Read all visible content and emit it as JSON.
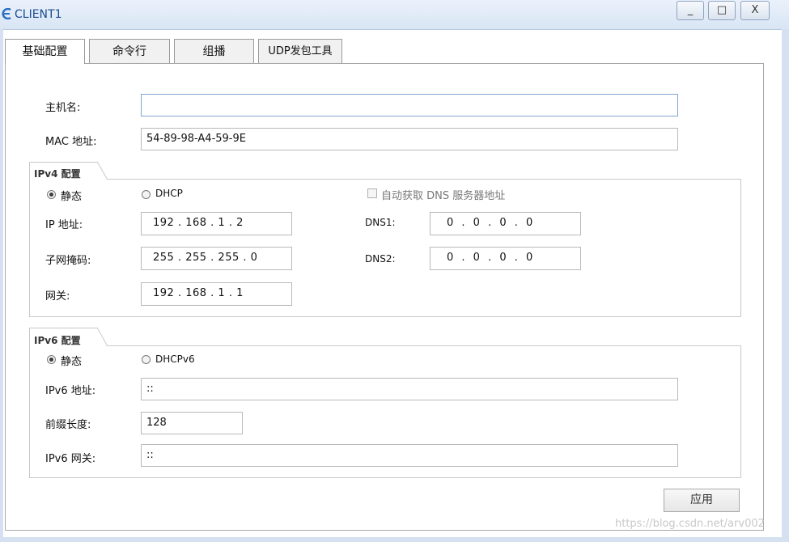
{
  "window": {
    "title": "CLIENT1",
    "minimize": "_",
    "maximize": "□",
    "close": "X"
  },
  "tabs": [
    {
      "label": "基础配置",
      "active": true
    },
    {
      "label": "命令行",
      "active": false
    },
    {
      "label": "组播",
      "active": false
    },
    {
      "label": "UDP发包工具",
      "active": false
    }
  ],
  "form": {
    "hostname_label": "主机名:",
    "hostname_value": "",
    "mac_label": "MAC 地址:",
    "mac_value": "54-89-98-A4-59-9E"
  },
  "ipv4": {
    "title": "IPv4 配置",
    "static_label": "静态",
    "dhcp_label": "DHCP",
    "auto_dns_label": "自动获取 DNS 服务器地址",
    "ip_label": "IP 地址:",
    "ip_value": "192 . 168 . 1 . 2",
    "mask_label": "子网掩码:",
    "mask_value": "255 . 255 . 255 . 0",
    "gateway_label": "网关:",
    "gateway_value": "192 . 168 . 1 . 1",
    "dns1_label": "DNS1:",
    "dns1_value": "0 . 0 . 0 . 0",
    "dns2_label": "DNS2:",
    "dns2_value": "0 . 0 . 0 . 0"
  },
  "ipv6": {
    "title": "IPv6 配置",
    "static_label": "静态",
    "dhcp_label": "DHCPv6",
    "addr_label": "IPv6 地址:",
    "addr_value": "::",
    "prefix_label": "前缀长度:",
    "prefix_value": "128",
    "gateway_label": "IPv6 网关:",
    "gateway_value": "::"
  },
  "apply_label": "应用",
  "watermark": "https://blog.csdn.net/arv002"
}
